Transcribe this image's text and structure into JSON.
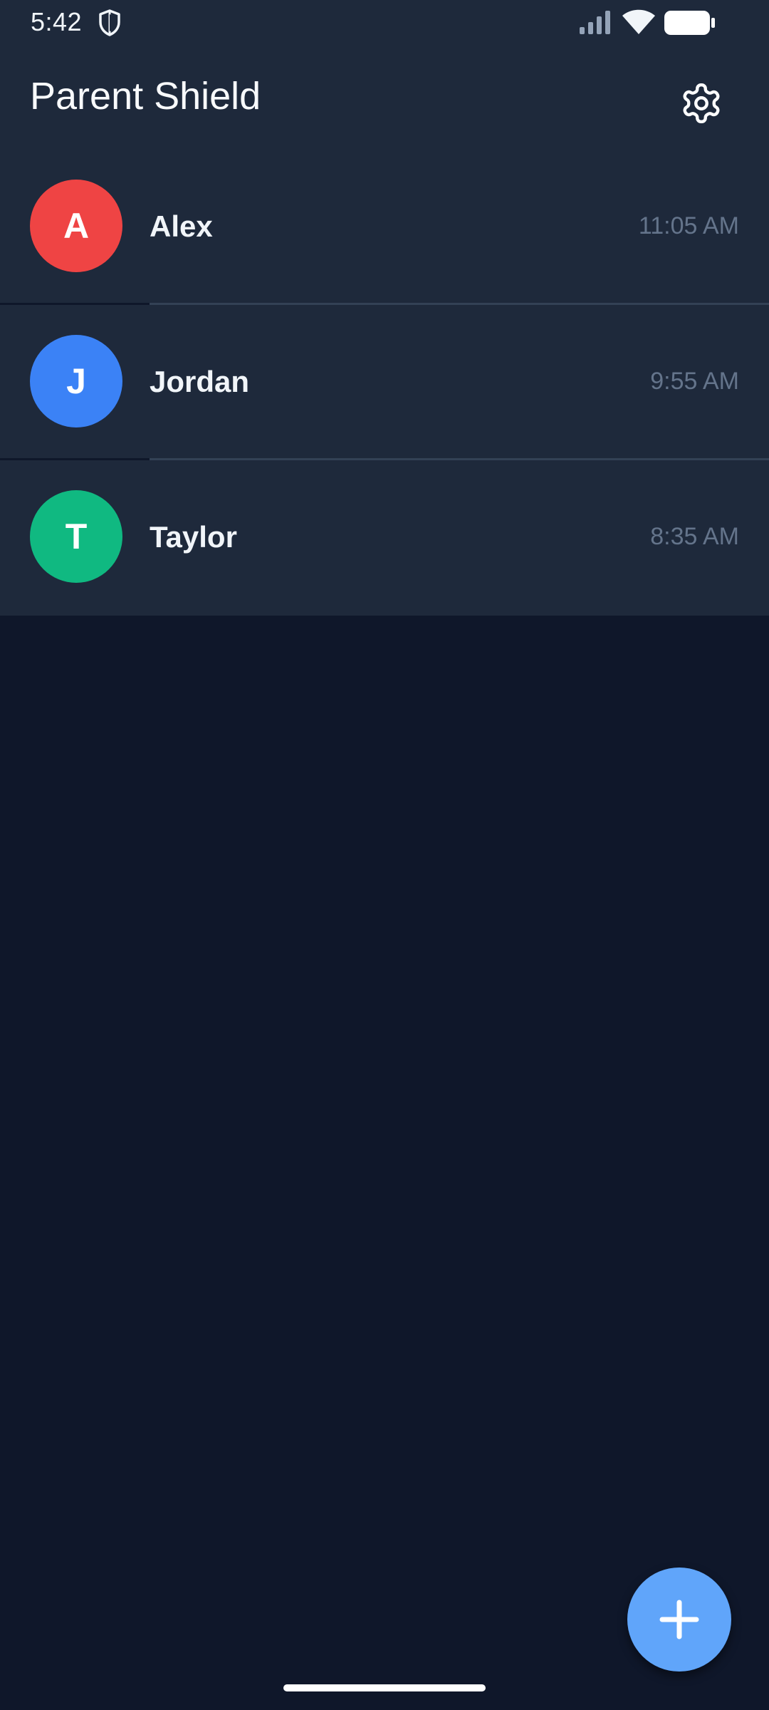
{
  "status_bar": {
    "time": "5:42",
    "icons": [
      "shield-icon",
      "signal-icon",
      "wifi-icon",
      "battery-icon"
    ]
  },
  "app_bar": {
    "title": "Parent Shield",
    "settings_icon": "gear-icon"
  },
  "children": [
    {
      "initial": "A",
      "name": "Alex",
      "time": "11:05 AM",
      "color": "#ef4444"
    },
    {
      "initial": "J",
      "name": "Jordan",
      "time": "9:55 AM",
      "color": "#3b82f6"
    },
    {
      "initial": "T",
      "name": "Taylor",
      "time": "8:35 AM",
      "color": "#10b981"
    }
  ],
  "fab": {
    "icon": "plus-icon"
  },
  "colors": {
    "background": "#0f172a",
    "surface": "#1e293b",
    "divider": "#334155",
    "accent": "#60a5fa",
    "muted_text": "#64748b"
  }
}
